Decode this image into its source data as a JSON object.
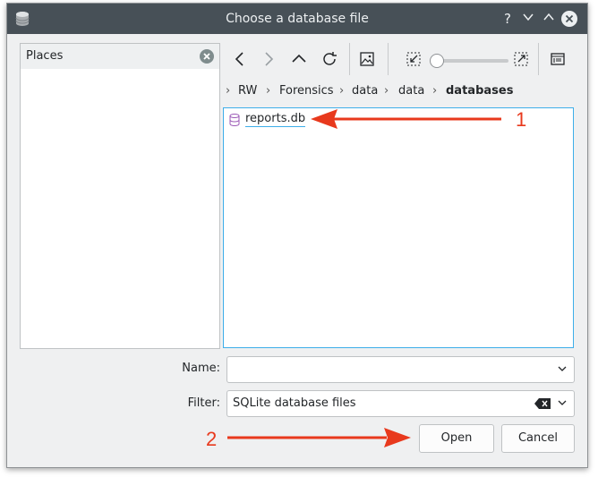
{
  "window": {
    "title": "Choose a database file"
  },
  "titlebar": {
    "help": "?",
    "minimize": "⌄",
    "maximize": "⌃"
  },
  "places": {
    "header": "Places"
  },
  "breadcrumb": [
    "RW",
    "Forensics",
    "data",
    "data",
    "databases"
  ],
  "files": [
    {
      "name": "reports.db"
    }
  ],
  "form": {
    "name_label": "Name:",
    "name_value": "",
    "filter_label": "Filter:",
    "filter_value": "SQLite database files"
  },
  "buttons": {
    "open": "Open",
    "cancel": "Cancel"
  },
  "annotations": {
    "first": "1",
    "second": "2"
  },
  "colors": {
    "titlebar": "#475057",
    "accent": "#3daee9",
    "annotation": "#e8391d",
    "db_icon": "#9b59b6"
  }
}
